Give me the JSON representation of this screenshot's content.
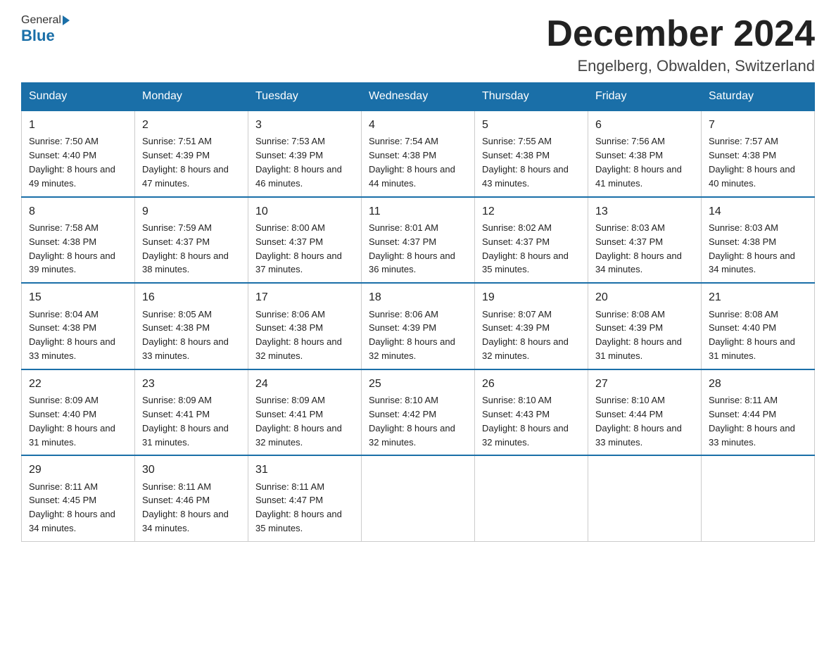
{
  "header": {
    "logo_general": "General",
    "logo_blue": "Blue",
    "month_title": "December 2024",
    "location": "Engelberg, Obwalden, Switzerland"
  },
  "days_of_week": [
    "Sunday",
    "Monday",
    "Tuesday",
    "Wednesday",
    "Thursday",
    "Friday",
    "Saturday"
  ],
  "weeks": [
    [
      {
        "day": "1",
        "sunrise": "7:50 AM",
        "sunset": "4:40 PM",
        "daylight": "8 hours and 49 minutes."
      },
      {
        "day": "2",
        "sunrise": "7:51 AM",
        "sunset": "4:39 PM",
        "daylight": "8 hours and 47 minutes."
      },
      {
        "day": "3",
        "sunrise": "7:53 AM",
        "sunset": "4:39 PM",
        "daylight": "8 hours and 46 minutes."
      },
      {
        "day": "4",
        "sunrise": "7:54 AM",
        "sunset": "4:38 PM",
        "daylight": "8 hours and 44 minutes."
      },
      {
        "day": "5",
        "sunrise": "7:55 AM",
        "sunset": "4:38 PM",
        "daylight": "8 hours and 43 minutes."
      },
      {
        "day": "6",
        "sunrise": "7:56 AM",
        "sunset": "4:38 PM",
        "daylight": "8 hours and 41 minutes."
      },
      {
        "day": "7",
        "sunrise": "7:57 AM",
        "sunset": "4:38 PM",
        "daylight": "8 hours and 40 minutes."
      }
    ],
    [
      {
        "day": "8",
        "sunrise": "7:58 AM",
        "sunset": "4:38 PM",
        "daylight": "8 hours and 39 minutes."
      },
      {
        "day": "9",
        "sunrise": "7:59 AM",
        "sunset": "4:37 PM",
        "daylight": "8 hours and 38 minutes."
      },
      {
        "day": "10",
        "sunrise": "8:00 AM",
        "sunset": "4:37 PM",
        "daylight": "8 hours and 37 minutes."
      },
      {
        "day": "11",
        "sunrise": "8:01 AM",
        "sunset": "4:37 PM",
        "daylight": "8 hours and 36 minutes."
      },
      {
        "day": "12",
        "sunrise": "8:02 AM",
        "sunset": "4:37 PM",
        "daylight": "8 hours and 35 minutes."
      },
      {
        "day": "13",
        "sunrise": "8:03 AM",
        "sunset": "4:37 PM",
        "daylight": "8 hours and 34 minutes."
      },
      {
        "day": "14",
        "sunrise": "8:03 AM",
        "sunset": "4:38 PM",
        "daylight": "8 hours and 34 minutes."
      }
    ],
    [
      {
        "day": "15",
        "sunrise": "8:04 AM",
        "sunset": "4:38 PM",
        "daylight": "8 hours and 33 minutes."
      },
      {
        "day": "16",
        "sunrise": "8:05 AM",
        "sunset": "4:38 PM",
        "daylight": "8 hours and 33 minutes."
      },
      {
        "day": "17",
        "sunrise": "8:06 AM",
        "sunset": "4:38 PM",
        "daylight": "8 hours and 32 minutes."
      },
      {
        "day": "18",
        "sunrise": "8:06 AM",
        "sunset": "4:39 PM",
        "daylight": "8 hours and 32 minutes."
      },
      {
        "day": "19",
        "sunrise": "8:07 AM",
        "sunset": "4:39 PM",
        "daylight": "8 hours and 32 minutes."
      },
      {
        "day": "20",
        "sunrise": "8:08 AM",
        "sunset": "4:39 PM",
        "daylight": "8 hours and 31 minutes."
      },
      {
        "day": "21",
        "sunrise": "8:08 AM",
        "sunset": "4:40 PM",
        "daylight": "8 hours and 31 minutes."
      }
    ],
    [
      {
        "day": "22",
        "sunrise": "8:09 AM",
        "sunset": "4:40 PM",
        "daylight": "8 hours and 31 minutes."
      },
      {
        "day": "23",
        "sunrise": "8:09 AM",
        "sunset": "4:41 PM",
        "daylight": "8 hours and 31 minutes."
      },
      {
        "day": "24",
        "sunrise": "8:09 AM",
        "sunset": "4:41 PM",
        "daylight": "8 hours and 32 minutes."
      },
      {
        "day": "25",
        "sunrise": "8:10 AM",
        "sunset": "4:42 PM",
        "daylight": "8 hours and 32 minutes."
      },
      {
        "day": "26",
        "sunrise": "8:10 AM",
        "sunset": "4:43 PM",
        "daylight": "8 hours and 32 minutes."
      },
      {
        "day": "27",
        "sunrise": "8:10 AM",
        "sunset": "4:44 PM",
        "daylight": "8 hours and 33 minutes."
      },
      {
        "day": "28",
        "sunrise": "8:11 AM",
        "sunset": "4:44 PM",
        "daylight": "8 hours and 33 minutes."
      }
    ],
    [
      {
        "day": "29",
        "sunrise": "8:11 AM",
        "sunset": "4:45 PM",
        "daylight": "8 hours and 34 minutes."
      },
      {
        "day": "30",
        "sunrise": "8:11 AM",
        "sunset": "4:46 PM",
        "daylight": "8 hours and 34 minutes."
      },
      {
        "day": "31",
        "sunrise": "8:11 AM",
        "sunset": "4:47 PM",
        "daylight": "8 hours and 35 minutes."
      },
      null,
      null,
      null,
      null
    ]
  ]
}
